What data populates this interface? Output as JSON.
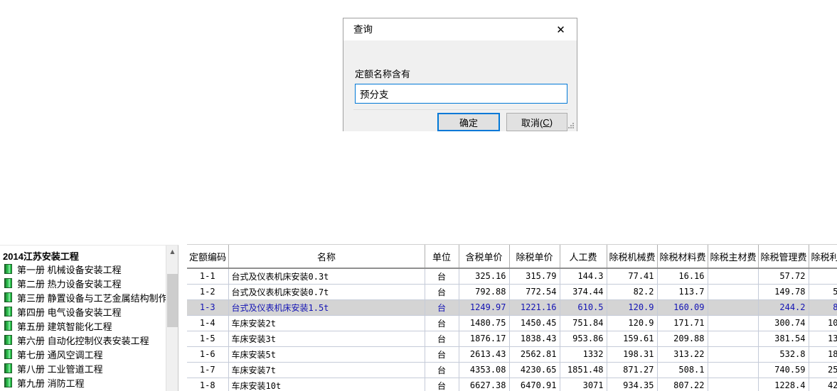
{
  "dialog": {
    "title": "查询",
    "close_icon": "close-icon",
    "label": "定额名称含有",
    "input_value": "预分支",
    "input_placeholder": "",
    "ok_label": "确定",
    "cancel_label_pre": "取消(",
    "cancel_accel": "C",
    "cancel_label_post": ")",
    "resize_grip": "resize-grip"
  },
  "sidebar": {
    "root_label": "2014江苏安装工程",
    "scroll_up_icon": "chevron-up-icon",
    "items": [
      {
        "label": "第一册 机械设备安装工程"
      },
      {
        "label": "第二册 热力设备安装工程"
      },
      {
        "label": "第三册 静置设备与工艺金属结构制作安装工程"
      },
      {
        "label": "第四册 电气设备安装工程"
      },
      {
        "label": "第五册 建筑智能化工程"
      },
      {
        "label": "第六册 自动化控制仪表安装工程"
      },
      {
        "label": "第七册 通风空调工程"
      },
      {
        "label": "第八册 工业管道工程"
      },
      {
        "label": "第九册 消防工程"
      }
    ]
  },
  "table": {
    "columns": [
      "定额编码",
      "名称",
      "单位",
      "含税单价",
      "除税单价",
      "人工费",
      "除税机械费",
      "除税材料费",
      "除税主材费",
      "除税管理费",
      "除税利"
    ],
    "rows": [
      {
        "selected": false,
        "cells": [
          "1-1",
          "台式及仪表机床安装0.3t",
          "台",
          "325.16",
          "315.79",
          "144.3",
          "77.41",
          "16.16",
          "",
          "57.72",
          ""
        ]
      },
      {
        "selected": false,
        "cells": [
          "1-2",
          "台式及仪表机床安装0.7t",
          "台",
          "792.88",
          "772.54",
          "374.44",
          "82.2",
          "113.7",
          "",
          "149.78",
          "5"
        ]
      },
      {
        "selected": true,
        "cells": [
          "1-3",
          "台式及仪表机床安装1.5t",
          "台",
          "1249.97",
          "1221.16",
          "610.5",
          "120.9",
          "160.09",
          "",
          "244.2",
          "8"
        ]
      },
      {
        "selected": false,
        "cells": [
          "1-4",
          "车床安装2t",
          "台",
          "1480.75",
          "1450.45",
          "751.84",
          "120.9",
          "171.71",
          "",
          "300.74",
          "10"
        ]
      },
      {
        "selected": false,
        "cells": [
          "1-5",
          "车床安装3t",
          "台",
          "1876.17",
          "1838.43",
          "953.86",
          "159.61",
          "209.88",
          "",
          "381.54",
          "13"
        ]
      },
      {
        "selected": false,
        "cells": [
          "1-6",
          "车床安装5t",
          "台",
          "2613.43",
          "2562.81",
          "1332",
          "198.31",
          "313.22",
          "",
          "532.8",
          "18"
        ]
      },
      {
        "selected": false,
        "cells": [
          "1-7",
          "车床安装7t",
          "台",
          "4353.08",
          "4230.65",
          "1851.48",
          "871.27",
          "508.1",
          "",
          "740.59",
          "25"
        ]
      },
      {
        "selected": false,
        "cells": [
          "1-8",
          "车床安装10t",
          "台",
          "6627.38",
          "6470.91",
          "3071",
          "934.35",
          "807.22",
          "",
          "1228.4",
          "42"
        ]
      }
    ]
  },
  "colors": {
    "accent": "#0078d7",
    "selected_row_bg": "#d4d4d4",
    "selected_row_text": "#1414b4",
    "tree_icon_green": "#2fbf4f"
  }
}
